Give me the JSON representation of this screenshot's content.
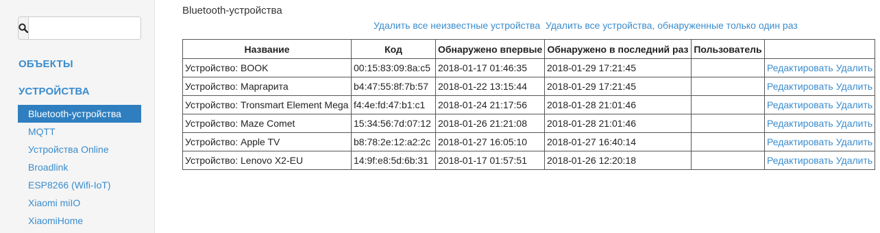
{
  "search": {
    "value": "",
    "placeholder": ""
  },
  "sidebar": {
    "sections": [
      "ОБЪЕКТЫ",
      "УСТРОЙСТВА"
    ],
    "items": [
      {
        "label": "Bluetooth-устройства",
        "active": true
      },
      {
        "label": "MQTT"
      },
      {
        "label": "Устройства Online"
      },
      {
        "label": "Broadlink"
      },
      {
        "label": "ESP8266 (Wifi-IoT)"
      },
      {
        "label": "Xiaomi miIO"
      },
      {
        "label": "XiaomiHome"
      }
    ]
  },
  "main": {
    "title": "Bluetooth-устройства",
    "actions": [
      "Удалить все неизвестные устройства",
      "Удалить все устройства, обнаруженные только один раз"
    ],
    "table": {
      "headers": [
        "Название",
        "Код",
        "Обнаружено впервые",
        "Обнаружено в последний раз",
        "Пользователь",
        ""
      ],
      "edit_label": "Редактировать",
      "delete_label": "Удалить",
      "rows": [
        {
          "name": "Устройство: BOOK",
          "code": "00:15:83:09:8a:c5",
          "first": "2018-01-17 01:46:35",
          "last": "2018-01-29 17:21:45",
          "user": ""
        },
        {
          "name": "Устройство: Маргарита",
          "code": "b4:47:55:8f:7b:57",
          "first": "2018-01-22 13:15:44",
          "last": "2018-01-29 17:21:45",
          "user": ""
        },
        {
          "name": "Устройство: Tronsmart Element Mega",
          "code": "f4:4e:fd:47:b1:c1",
          "first": "2018-01-24 21:17:56",
          "last": "2018-01-28 21:01:46",
          "user": ""
        },
        {
          "name": "Устройство: Maze Comet",
          "code": "15:34:56:7d:07:12",
          "first": "2018-01-26 21:21:08",
          "last": "2018-01-28 21:01:46",
          "user": ""
        },
        {
          "name": "Устройство: Apple TV",
          "code": "b8:78:2e:12:a2:2c",
          "first": "2018-01-27 16:05:10",
          "last": "2018-01-27 16:40:14",
          "user": ""
        },
        {
          "name": "Устройство: Lenovo X2-EU",
          "code": "14:9f:e8:5d:6b:31",
          "first": "2018-01-17 01:57:51",
          "last": "2018-01-26 12:20:18",
          "user": ""
        }
      ]
    }
  }
}
